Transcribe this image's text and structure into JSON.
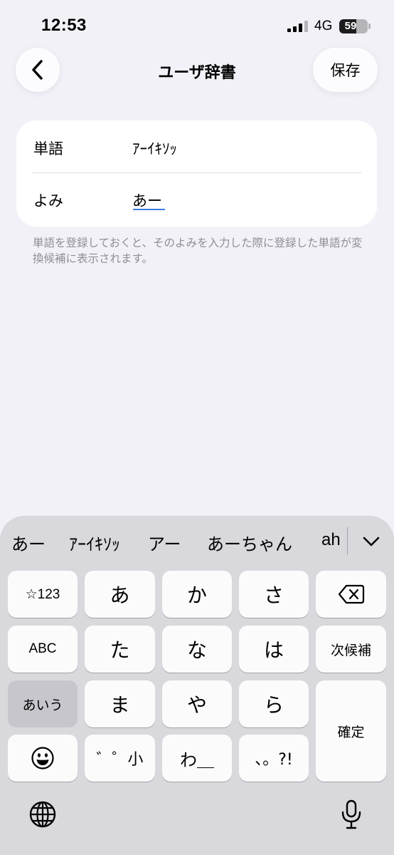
{
  "status_bar": {
    "time": "12:53",
    "network": "4G",
    "battery": "59",
    "battery_level": 0.59
  },
  "nav": {
    "title": "ユーザ辞書",
    "save_label": "保存",
    "back_icon": "chevron-left-icon"
  },
  "form": {
    "word_label": "単語",
    "word_value": "ｱｰｲｷｿｯ",
    "reading_label": "よみ",
    "reading_value": "あー",
    "note": "単語を登録しておくと、そのよみを入力した際に登録した単語が変換候補に表示されます。"
  },
  "keyboard": {
    "candidates": [
      "あー",
      "ｱｰｲｷｿｯ",
      "アー",
      "あーちゃん",
      "ah"
    ],
    "keys": {
      "symbols": "☆123",
      "abc": "ABC",
      "kana": "あいう",
      "a": "あ",
      "ka": "か",
      "sa": "さ",
      "ta": "た",
      "na": "な",
      "ha": "は",
      "ma": "ま",
      "ya": "や",
      "ra": "ら",
      "dakuten": "゛゜小",
      "wa": "わ＿",
      "punct": "、。?!",
      "next_candidate": "次候補",
      "confirm": "確定"
    }
  }
}
